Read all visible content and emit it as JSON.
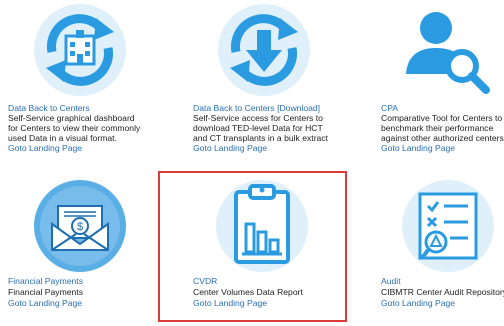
{
  "colors": {
    "tile_blue": "#2a9be0",
    "tile_light": "#dff0fb",
    "link": "#2a6fb5",
    "highlight": "#d93b3b"
  },
  "tiles": [
    {
      "icon": "hospital-sync-icon",
      "title": "Data Back to Centers",
      "desc": [
        "Self-Service graphical dashboard",
        "for Centers to view their commonly",
        "used Data in a visual format."
      ],
      "link": "Goto Landing Page"
    },
    {
      "icon": "download-sync-icon",
      "title": "Data Back to Centers [Download]",
      "desc": [
        "Self-Service access for Centers to",
        "download TED-level Data for HCT",
        "and CT transplants in a bulk extract"
      ],
      "link": "Goto Landing Page"
    },
    {
      "icon": "user-search-icon",
      "title": "CPA",
      "desc": [
        "Comparative Tool for Centers to",
        "benchmark their performance",
        "against other authorized centers"
      ],
      "link": "Goto Landing Page"
    },
    {
      "icon": "payment-envelope-icon",
      "title": "Financial Payments",
      "desc": [
        "Financial Payments"
      ],
      "link": "Goto Landing Page"
    },
    {
      "icon": "clipboard-chart-icon",
      "title": "CVDR",
      "desc": [
        "Center Volumes Data Report"
      ],
      "link": "Goto Landing Page"
    },
    {
      "icon": "audit-checklist-icon",
      "title": "Audit",
      "desc": [
        "CIBMTR Center Audit Repository"
      ],
      "link": "Goto Landing Page"
    }
  ]
}
